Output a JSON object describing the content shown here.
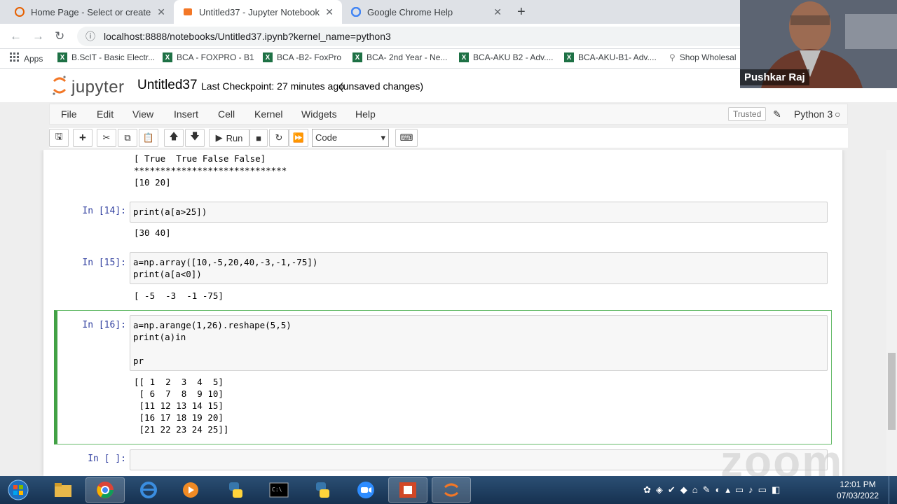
{
  "browser": {
    "tabs": [
      {
        "title": "Home Page - Select or create a n",
        "close": "✕"
      },
      {
        "title": "Untitled37 - Jupyter Notebook",
        "close": "✕"
      },
      {
        "title": "Google Chrome Help",
        "close": "✕"
      }
    ],
    "new_tab": "+",
    "url": "localhost:8888/notebooks/Untitled37.ipynb?kernel_name=python3",
    "bookmarks": [
      {
        "label": "Apps"
      },
      {
        "label": "B.ScIT - Basic Electr..."
      },
      {
        "label": "BCA - FOXPRO - B1"
      },
      {
        "label": "BCA -B2- FoxPro"
      },
      {
        "label": "BCA- 2nd Year - Ne..."
      },
      {
        "label": "BCA-AKU B2 - Adv...."
      },
      {
        "label": "BCA-AKU-B1- Adv...."
      },
      {
        "label": "Shop Wholesal"
      }
    ]
  },
  "jupyter": {
    "logo_text": "jupyter",
    "notebook_title": "Untitled37",
    "checkpoint": "Last Checkpoint: 27 minutes ago",
    "unsaved": "(unsaved changes)",
    "menu": [
      "File",
      "Edit",
      "View",
      "Insert",
      "Cell",
      "Kernel",
      "Widgets",
      "Help"
    ],
    "trusted": "Trusted",
    "kernel": "Python 3",
    "run_label": "Run",
    "cell_type": "Code"
  },
  "cells": {
    "prev_out_1": "[ True  True False False]",
    "prev_out_2": "*****************************",
    "prev_out_3": "[10 20]",
    "c14_prompt": "In [14]:",
    "c14_code": "print(a[a>25])",
    "c14_out": "[30 40]",
    "c15_prompt": "In [15]:",
    "c15_code": "a=np.array([10,-5,20,40,-3,-1,-75])\nprint(a[a<0])",
    "c15_out": "[ -5  -3  -1 -75]",
    "c16_prompt": "In [16]:",
    "c16_code": "a=np.arange(1,26).reshape(5,5)\nprint(a)in\n\npr",
    "c16_out": "[[ 1  2  3  4  5]\n [ 6  7  8  9 10]\n [11 12 13 14 15]\n [16 17 18 19 20]\n [21 22 23 24 25]]",
    "empty_prompt": "In [ ]:"
  },
  "webcam": {
    "name": "Pushkar Raj"
  },
  "watermark": "zoom",
  "taskbar": {
    "time": "12:01 PM",
    "date": "07/03/2022"
  }
}
